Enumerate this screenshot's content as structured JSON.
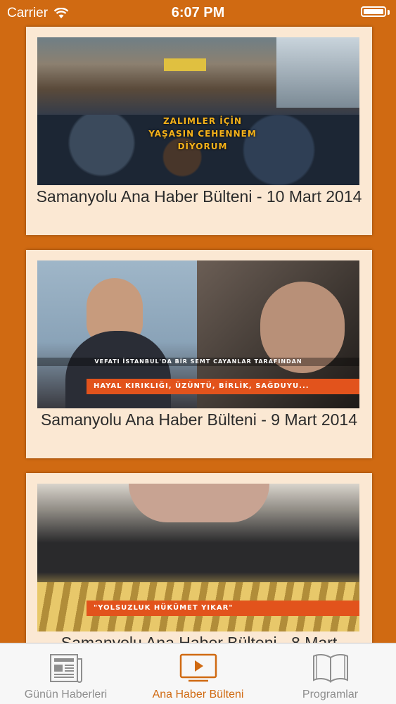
{
  "status_bar": {
    "carrier": "Carrier",
    "time": "6:07 PM"
  },
  "feed": {
    "items": [
      {
        "title": "Samanyolu Ana Haber Bülteni - 10 Mart 2014",
        "caption_lines": [
          "ZALIMLER İÇİN",
          "YAŞASIN CEHENNEM",
          "DİYORUM"
        ]
      },
      {
        "title": "Samanyolu Ana Haber Bülteni - 9 Mart 2014",
        "ticker": "VEFATI İSTANBUL'DA BİR SEMT CAYANLAR TARAFINDAN",
        "caption": "HAYAL KIRIKLIĞI, ÜZÜNTÜ, BİRLİK, SAĞDUYU..."
      },
      {
        "title": "Samanyolu Ana Haber Bülteni - 8 Mart",
        "caption": "\"YOLSUZLUK HÜKÜMET YIKAR\""
      }
    ]
  },
  "tab_bar": {
    "tabs": [
      {
        "label": "Günün Haberleri",
        "icon": "newspaper-icon",
        "active": false
      },
      {
        "label": "Ana Haber Bülteni",
        "icon": "video-play-icon",
        "active": true
      },
      {
        "label": "Programlar",
        "icon": "book-icon",
        "active": false
      }
    ]
  },
  "colors": {
    "accent": "#d06a12",
    "card_background": "#fbe8d3",
    "tab_inactive": "#8e8e8e"
  }
}
